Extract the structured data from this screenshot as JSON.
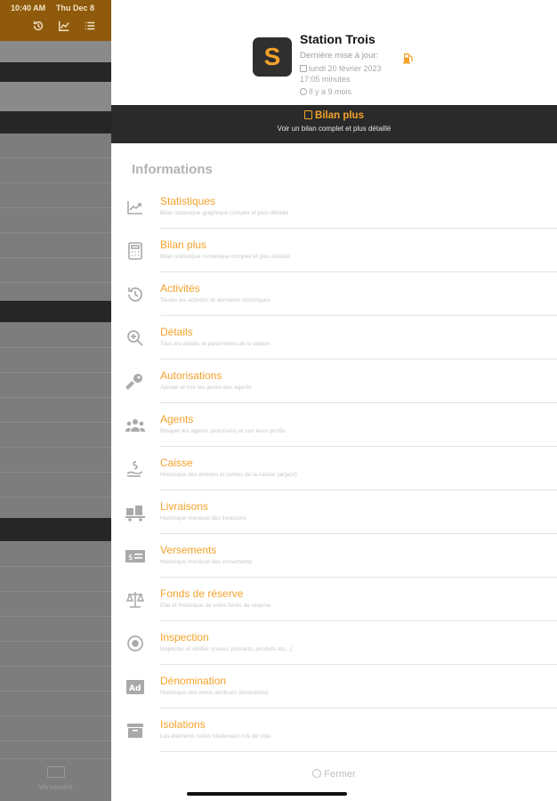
{
  "status_bar": {
    "time": "10:40 AM",
    "date": "Thu Dec 8"
  },
  "left_panel": {
    "bottom_label": "Versement"
  },
  "header": {
    "logo_letter": "S",
    "station_name": "Station Trois",
    "last_update_label": "Dernière mise à jour:",
    "last_update_date": "lundi 20 février 2023",
    "last_update_time": "17:05 minutes",
    "relative_time": "Il y a 9 mois"
  },
  "banner": {
    "title": "Bilan plus",
    "subtitle": "Voir un bilan complet et plus détaillé"
  },
  "section_title": "Informations",
  "menu": [
    {
      "label": "Statistiques",
      "desc": "Bilan statistique graphique complet et plus détaillé",
      "icon": "chart-line-icon"
    },
    {
      "label": "Bilan plus",
      "desc": "Bilan statistique numérique complet et plus détaillé",
      "icon": "calculator-icon"
    },
    {
      "label": "Activités",
      "desc": "Toutes les activités et dernières historiques",
      "icon": "history-icon"
    },
    {
      "label": "Détails",
      "desc": "Tous les détails et paramètres de la station",
      "icon": "zoom-in-icon"
    },
    {
      "label": "Autorisations",
      "desc": "Ajouter et voir les accès des agents",
      "icon": "key-icon"
    },
    {
      "label": "Agents",
      "desc": "Bloquer les agents (autorisés) et voir leurs profils",
      "icon": "people-icon"
    },
    {
      "label": "Caisse",
      "desc": "Historique des entrées et sorties de la caisse (argent)",
      "icon": "hand-money-icon"
    },
    {
      "label": "Livraisons",
      "desc": "Historique mensuel des livraisons",
      "icon": "truck-icon"
    },
    {
      "label": "Versements",
      "desc": "Historique mensuel des versements",
      "icon": "money-check-icon"
    },
    {
      "label": "Fonds de réserve",
      "desc": "Etat et historique de votre fonds de réserve",
      "icon": "balance-scale-icon"
    },
    {
      "label": "Inspection",
      "desc": "Inspecter et vérifier (cuves, pistolets, produits etc...)",
      "icon": "target-icon"
    },
    {
      "label": "Dénomination",
      "desc": "Historique des noms attribués (évolutions)",
      "icon": "ad-icon"
    },
    {
      "label": "Isolations",
      "desc": "Les éléments isolés totalement mis de côté",
      "icon": "archive-icon"
    }
  ],
  "close_label": "Fermer",
  "colors": {
    "accent": "#f3a22a",
    "dark_band": "#2a2a2a",
    "header_brown": "#8f5a0b"
  }
}
